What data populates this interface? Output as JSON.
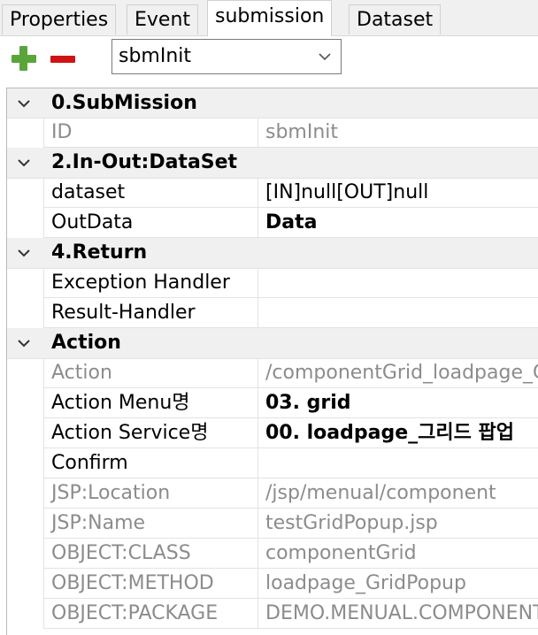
{
  "tabs": [
    {
      "label": "Properties",
      "active": false
    },
    {
      "label": "Event",
      "active": false
    },
    {
      "label": "submission",
      "active": true
    },
    {
      "label": "Dataset",
      "active": false
    }
  ],
  "toolbar": {
    "add_icon": "plus-icon",
    "remove_icon": "minus-icon",
    "submission_select": {
      "value": "sbmInit"
    }
  },
  "colors": {
    "add": "#5aa53a",
    "remove": "#d11212",
    "category_bg": "#f0f0f0",
    "disabled_text": "#8c8c8c"
  },
  "categories": {
    "submission": {
      "label": "0.SubMission",
      "props": [
        {
          "name": "ID",
          "value": "sbmInit"
        }
      ]
    },
    "inout": {
      "label": "2.In-Out:DataSet",
      "props": [
        {
          "name": "dataset",
          "value": "[IN]null[OUT]null"
        },
        {
          "name": "OutData",
          "value": "Data"
        }
      ]
    },
    "return": {
      "label": "4.Return",
      "props": [
        {
          "name": "Exception Handler",
          "value": ""
        },
        {
          "name": "Result-Handler",
          "value": ""
        }
      ]
    },
    "action": {
      "label": "Action",
      "props": [
        {
          "name": "Action",
          "value": "/componentGrid_loadpage_GridPopup"
        },
        {
          "name": "Action Menu명",
          "value": "03. grid"
        },
        {
          "name": "Action Service명",
          "value": "00. loadpage_그리드 팝업"
        },
        {
          "name": "Confirm",
          "value": ""
        },
        {
          "name": "JSP:Location",
          "value": "/jsp/menual/component"
        },
        {
          "name": "JSP:Name",
          "value": "testGridPopup.jsp"
        },
        {
          "name": "OBJECT:CLASS",
          "value": "componentGrid"
        },
        {
          "name": "OBJECT:METHOD",
          "value": "loadpage_GridPopup"
        },
        {
          "name": "OBJECT:PACKAGE",
          "value": "DEMO.MENUAL.COMPONENT"
        }
      ]
    }
  }
}
